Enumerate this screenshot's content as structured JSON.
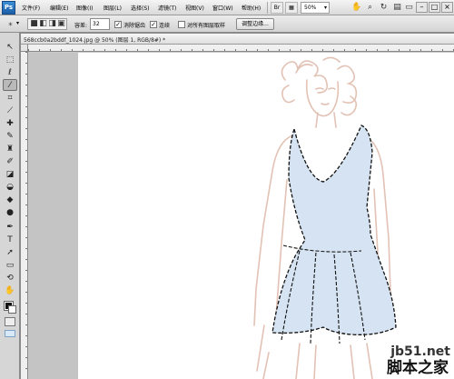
{
  "menubar": {
    "logo": "Ps",
    "items": [
      "文件(F)",
      "编辑(E)",
      "图像(I)",
      "图层(L)",
      "选择(S)",
      "滤镜(T)",
      "视图(V)",
      "窗口(W)",
      "帮助(H)"
    ],
    "zoom": "50%",
    "window_buttons": [
      "–",
      "□",
      "×"
    ]
  },
  "options": {
    "tolerance_label": "容差:",
    "tolerance_value": "32",
    "antialias_label": "消除锯齿",
    "contiguous_label": "连续",
    "all_layers_label": "对所有图层取样",
    "refine_label": "调整边缘..."
  },
  "document": {
    "tab_title": "568ccb0a2bddf_1024.jpg @ 50% (图层 1, RGB/8#) *"
  },
  "watermark": {
    "site": "jb51.net",
    "name": "脚本之家"
  },
  "colors": {
    "dress_fill": "#d5e3f2",
    "sketch_lines": "#e2c2b4"
  }
}
